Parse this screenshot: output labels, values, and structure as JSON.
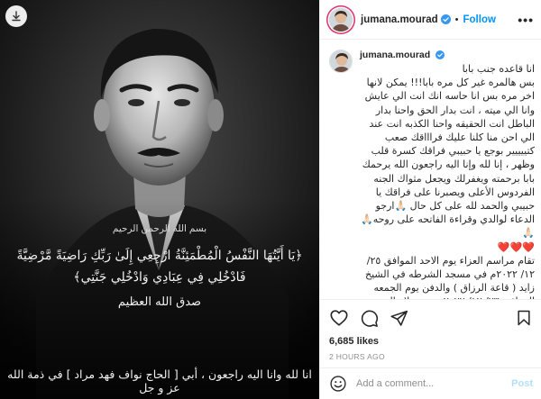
{
  "post": {
    "username": "jumana.mourad",
    "follow_label": "Follow",
    "more_label": "•••",
    "likes": "6,685 likes",
    "time": "2 HOURS AGO",
    "comment_placeholder": "Add a comment...",
    "post_label": "Post"
  },
  "caption": {
    "username": "jumana.mourad",
    "text": "انا قاعده جنب بابا\nبس هالمره غير كل مره بابا!!! يمكن لانها\nاخر مره بس انا حاسه انك انت الي عايش\nوانا الي ميته ، انت بدار الحق واحنا بدار\nالباطل انت الحقيقه واحنا الكذبه انت عند\nالي احن منا كلنا عليك فراااقك صعب\nكتييييير بوجع يا حبيبي فراقك كسرة قلب\nوظهر ، إنا لله وإنا اليه راجعون الله يرحمك\nبابا برحمته ويغفرلك ويجعل مثواك الجنه\nالفردوس الأعلى ويصبرنا على فراقك يا\nحبيبي والحمد لله على كل حال 🙏🏻ارجو\nالدعاء لوالدي وقراءة الفاتحه على روحه🙏🏻🙏🏻\n❤️❤️❤️\nتقام مراسم العزاء يوم الاحد الموافق ٢٥/\n١٢/ ٢٠٢٢م في مسجد الشرطه في الشيخ\nزايد ( قاعة الرزاق ) والدفن يوم الجمعه\nالموافق ٢٣/ ١٢/ ٢٠٢٢م بعد صلاه الجمعه\nفي مسجد الشرطه والدفن في مقابر\nاكتوبر"
  },
  "image_text": {
    "basmala": "بسم الله الرحمن الرحيم",
    "verse_line1": "﴿يَا أَيَّتُهَا النَّفْسُ الْمُطْمَئِنَّةُ ارْجِعِي إِلَىٰ رَبِّكِ رَاضِيَةً مَّرْضِيَّةً",
    "verse_line2": "فَادْخُلِي فِي عِبَادِي وَادْخُلِي جَنَّتِي﴾",
    "closing": "صدق الله العظيم",
    "bottom": "انا لله وانا اليه راجعون ، أبي [ الحاج نواف فهد مراد ] في ذمة الله عز و جل"
  },
  "colors": {
    "link_blue": "#0095f6",
    "post_disabled": "#b2dffc",
    "muted": "#8e8e8e",
    "story_ring": "#e1306c",
    "verified": "#3897f0"
  },
  "icons": {
    "download": "download-icon",
    "verified": "verified-badge-icon",
    "like": "heart-icon",
    "comment": "comment-icon",
    "share": "share-icon",
    "save": "bookmark-icon",
    "emoji": "emoji-icon"
  }
}
